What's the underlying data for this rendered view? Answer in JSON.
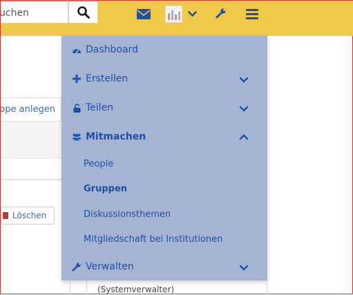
{
  "search": {
    "value": "uchen",
    "button_icon": "search-icon"
  },
  "navbar": {
    "icons": [
      "envelope-icon",
      "avatar",
      "chevron-down-icon",
      "wrench-icon",
      "menu-icon"
    ],
    "color": "#f0c94a"
  },
  "background": {
    "tab_label": "ppe anlegen",
    "delete_label": "Löschen",
    "bottom_text": "(Systemverwalter)"
  },
  "menu": {
    "items": [
      {
        "label": "Dashboard",
        "icon": "dashboard-icon"
      },
      {
        "label": "Erstellen",
        "icon": "plus-icon",
        "chevron": "chevron-down-icon"
      },
      {
        "label": "Teilen",
        "icon": "unlock-icon",
        "chevron": "chevron-down-icon"
      },
      {
        "label": "Mitmachen",
        "icon": "users-icon",
        "chevron": "chevron-up-icon",
        "expanded": true
      },
      {
        "label": "Verwalten",
        "icon": "wrench-icon",
        "chevron": "chevron-down-icon"
      }
    ],
    "subitems": [
      {
        "label": "People"
      },
      {
        "label": "Gruppen",
        "active": true
      },
      {
        "label": "Diskussionsthemen"
      },
      {
        "label": "Mitgliedschaft bei Institutionen"
      }
    ],
    "background_color": "#a5b4d2",
    "link_color": "#1f4fa8"
  }
}
